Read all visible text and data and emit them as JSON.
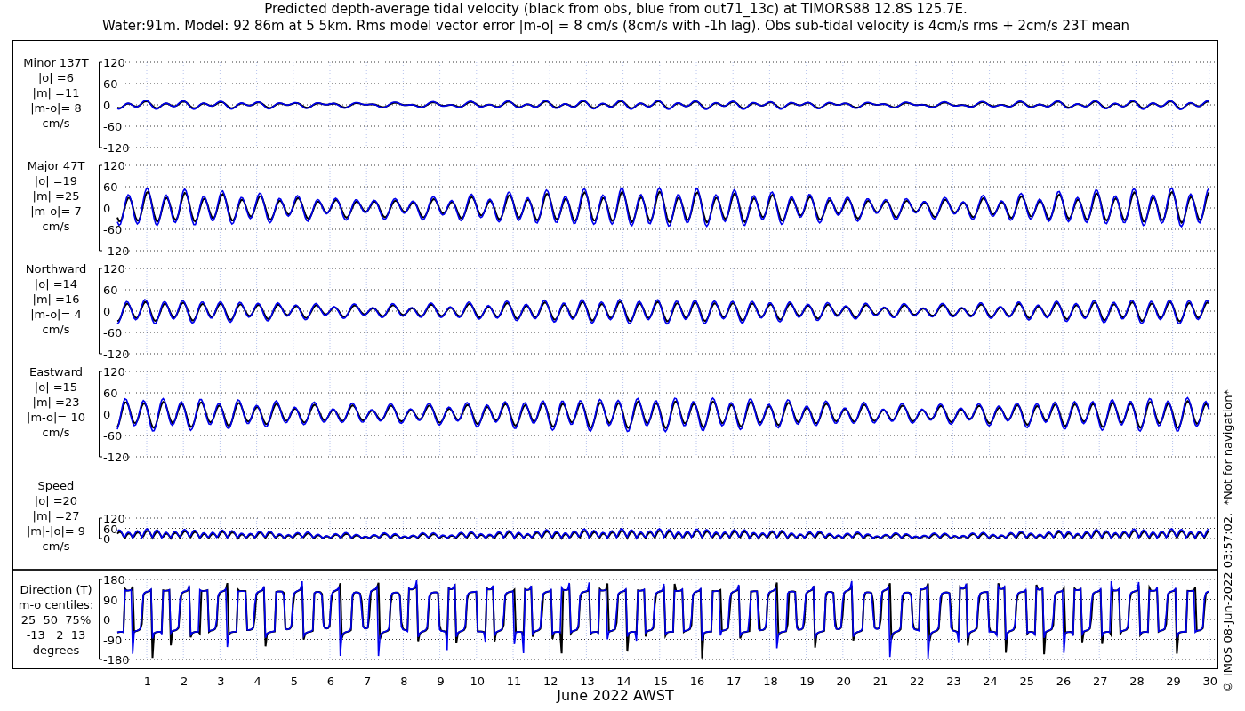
{
  "title_lines": [
    "Predicted depth-average tidal velocity (black from obs, blue from out71_13c) at TIMORS88 12.8S 125.7E.",
    "Water:91m. Model: 92 86m at 5 5km. Rms model vector error |m-o| = 8 cm/s (8cm/s with -1h lag). Obs sub-tidal velocity is 4cm/s rms + 2cm/s 23T mean"
  ],
  "panels": [
    {
      "kind": "signed",
      "label_lines": [
        "Minor 137T",
        "|o| =6",
        "|m| =11",
        "|m-o|= 8",
        "cm/s"
      ],
      "yticks": [
        "120",
        "60",
        "0",
        "-60",
        "-120"
      ]
    },
    {
      "kind": "signed",
      "label_lines": [
        "Major 47T",
        "|o| =19",
        "|m| =25",
        "|m-o|= 7",
        "cm/s"
      ],
      "yticks": [
        "120",
        "60",
        "0",
        "-60",
        "-120"
      ]
    },
    {
      "kind": "signed",
      "label_lines": [
        "Northward",
        "|o| =14",
        "|m| =16",
        "|m-o|= 4",
        "cm/s"
      ],
      "yticks": [
        "120",
        "60",
        "0",
        "-60",
        "-120"
      ]
    },
    {
      "kind": "signed",
      "label_lines": [
        "Eastward",
        "|o| =15",
        "|m| =23",
        "|m-o|= 10",
        "cm/s"
      ],
      "yticks": [
        "120",
        "60",
        "0",
        "-60",
        "-120"
      ]
    },
    {
      "kind": "speed",
      "label_lines": [
        "Speed",
        "|o| =20",
        "|m| =27",
        "|m|-|o|= 9",
        "cm/s"
      ],
      "yticks": [
        "120",
        "60",
        "0"
      ]
    },
    {
      "kind": "direction",
      "label_lines": [
        "Direction (T)",
        "m-o centiles:",
        "25  50  75%",
        "-13   2  13",
        "degrees"
      ],
      "yticks": [
        "180",
        "90",
        "0",
        "-90",
        "-180"
      ]
    }
  ],
  "xticks": [
    "1",
    "2",
    "3",
    "4",
    "5",
    "6",
    "7",
    "8",
    "9",
    "10",
    "11",
    "12",
    "13",
    "14",
    "15",
    "16",
    "17",
    "18",
    "19",
    "20",
    "21",
    "22",
    "23",
    "24",
    "25",
    "26",
    "27",
    "28",
    "29",
    "30"
  ],
  "xlabel": "June 2022 AWST",
  "footer": "© IMOS 08-Jun-2022 03:57:02.  *Not for navigation*"
}
